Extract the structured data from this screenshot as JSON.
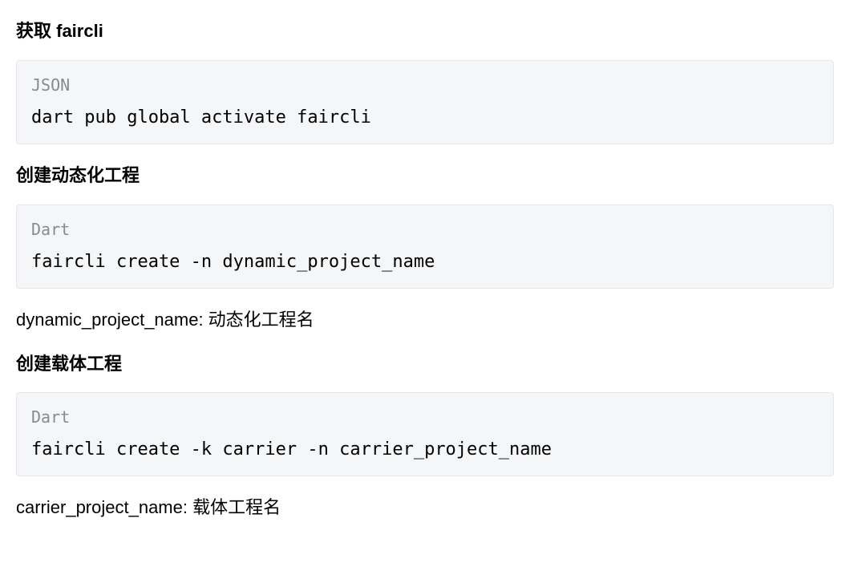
{
  "sections": [
    {
      "heading": "获取 faircli",
      "code_lang": "JSON",
      "code": "dart pub global activate faircli",
      "desc": null
    },
    {
      "heading": "创建动态化工程",
      "code_lang": "Dart",
      "code": "faircli create -n dynamic_project_name",
      "desc": "dynamic_project_name: 动态化工程名"
    },
    {
      "heading": "创建载体工程",
      "code_lang": "Dart",
      "code": "faircli create -k carrier -n carrier_project_name",
      "desc": "carrier_project_name: 载体工程名"
    }
  ]
}
